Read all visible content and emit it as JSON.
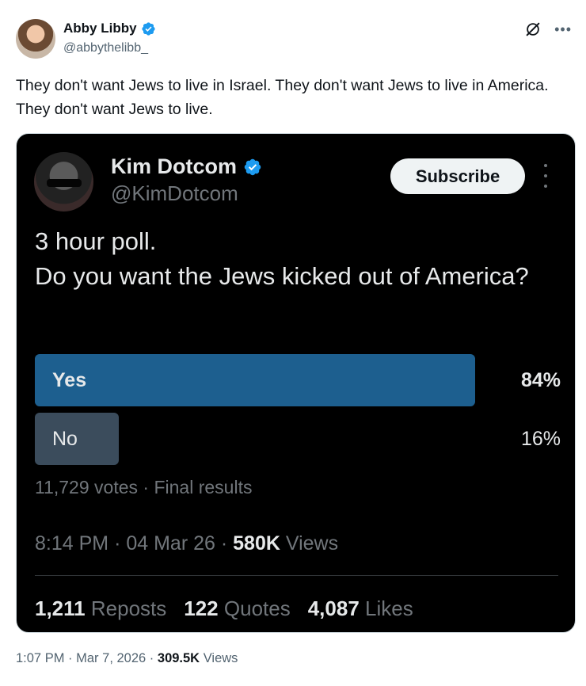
{
  "author": {
    "name": "Abby Libby",
    "handle": "@abbythelibb_"
  },
  "tweet_text": "They don't want Jews to live in Israel. They don't want Jews to live in America. They don't want Jews to live.",
  "quote": {
    "name": "Kim Dotcom",
    "handle": "@KimDotcom",
    "subscribe_label": "Subscribe",
    "text": "3 hour poll.\nDo you want the Jews kicked out of America?",
    "poll": {
      "options": [
        {
          "label": "Yes",
          "percent_text": "84%",
          "percent": 84,
          "color": "#1d5f8f"
        },
        {
          "label": "No",
          "percent_text": "16%",
          "percent": 16,
          "color": "#3b4c5c"
        }
      ],
      "votes": "11,729 votes",
      "sep": "·",
      "status": "Final results"
    },
    "time": "8:14 PM",
    "date": "04 Mar 26",
    "views_count": "580K",
    "views_label": "Views",
    "stats": {
      "reposts_count": "1,211",
      "reposts_label": "Reposts",
      "quotes_count": "122",
      "quotes_label": "Quotes",
      "likes_count": "4,087",
      "likes_label": "Likes"
    }
  },
  "footer": {
    "time": "1:07 PM",
    "date": "Mar 7, 2026",
    "views_count": "309.5K",
    "views_label": "Views",
    "sep": "·"
  },
  "icons": {
    "verified": "verified-badge-icon",
    "grok": "grok-icon",
    "more": "more-icon"
  },
  "colors": {
    "verified": "#1d9bf0",
    "quote_bg": "#000000"
  }
}
